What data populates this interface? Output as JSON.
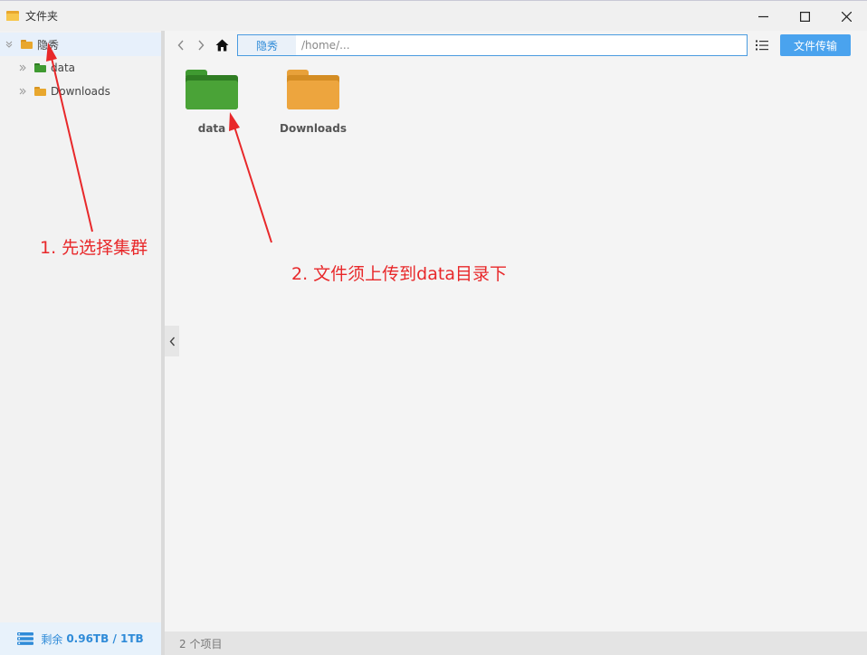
{
  "window": {
    "title": "文件夹"
  },
  "sidebar": {
    "tree": [
      {
        "label": "隐秀",
        "expanded": true,
        "color": "#e8a72e"
      },
      {
        "label": "data",
        "expanded": false,
        "color": "#3f9a31"
      },
      {
        "label": "Downloads",
        "expanded": false,
        "color": "#e8a72e"
      }
    ],
    "storage": {
      "label": "剩余",
      "value": "0.96TB / 1TB"
    }
  },
  "toolbar": {
    "breadcrumb": "隐秀",
    "path_value": "/home/..."
  },
  "toolbar_actions": {
    "transfer_label": "文件传输"
  },
  "content": {
    "folders": [
      {
        "name": "data",
        "color": "#3f9a31"
      },
      {
        "name": "Downloads",
        "color": "#e8a13a"
      }
    ]
  },
  "statusbar": {
    "count": "2 个项目"
  },
  "annotations": [
    {
      "text": "1. 先选择集群"
    },
    {
      "text": "2. 文件须上传到data目录下"
    }
  ],
  "colors": {
    "accent": "#4aa3ee",
    "annotation": "#e8282a"
  }
}
